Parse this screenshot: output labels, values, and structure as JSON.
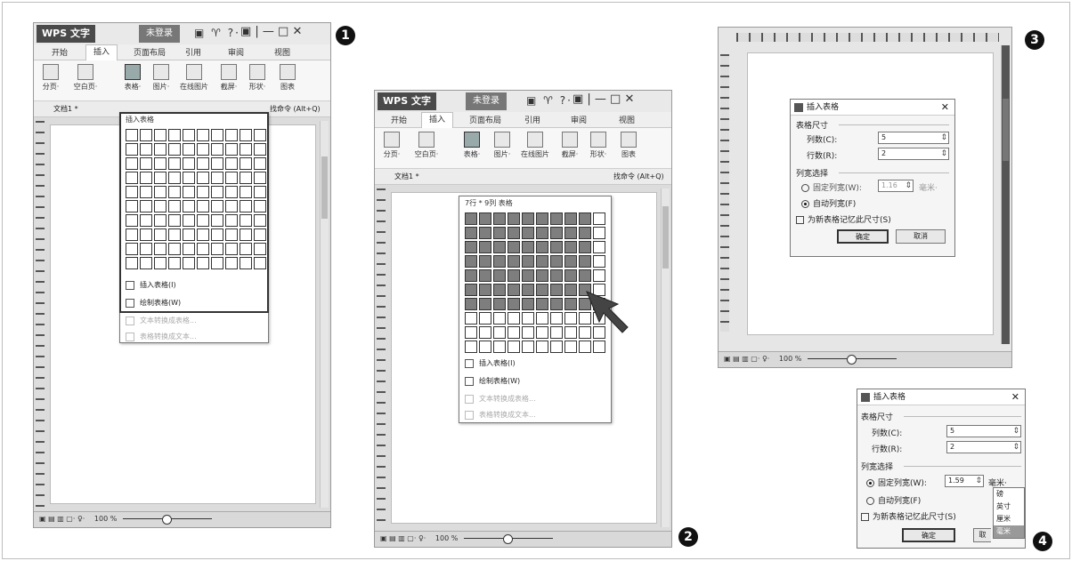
{
  "app": {
    "logo": "WPS 文字",
    "bubble_1": "未登录",
    "bubble_2": "未登录",
    "toolbar_icons": "▣ ♈ ?·",
    "window_controls": "▣ | — □ ✕"
  },
  "tabs": [
    "开始",
    "插入",
    "页面布局",
    "引用",
    "审阅",
    "视图"
  ],
  "ribbon": {
    "page_break": "分页·",
    "blank_page": "空白页·",
    "table": "表格·",
    "picture": "图片·",
    "online_picture": "在线图片",
    "screenshot": "截屏·",
    "shape": "形状·",
    "chart": "图表"
  },
  "docbar": {
    "doc_tab": "文档1 *",
    "command_hint": "找命令 (Alt+Q)"
  },
  "dropdown": {
    "header_1": "插入表格",
    "header_2": "7行 * 9列 表格",
    "insert_table": "插入表格(I)",
    "draw_table": "绘制表格(W)",
    "text_to_table": "文本转换成表格...",
    "table_to_text": "表格转换成文本..."
  },
  "statusbar": {
    "zoom": "100 %"
  },
  "dialog": {
    "title": "插入表格",
    "size_group": "表格尺寸",
    "cols_label": "列数(C):",
    "cols_value": "5",
    "rows_label": "行数(R):",
    "rows_value": "2",
    "width_group": "列宽选择",
    "fixed_width": "固定列宽(W):",
    "fixed_value_3": "1.16",
    "fixed_value_4": "1.59",
    "unit_3": "毫米·",
    "unit_4": "毫米·",
    "auto_width": "自动列宽(F)",
    "remember": "为新表格记忆此尺寸(S)",
    "ok": "确定",
    "cancel": "取消",
    "cancel_partial": "取"
  },
  "unit_options": [
    "磅",
    "英寸",
    "厘米",
    "毫米"
  ],
  "step_numbers": [
    "1",
    "2",
    "3",
    "4"
  ]
}
